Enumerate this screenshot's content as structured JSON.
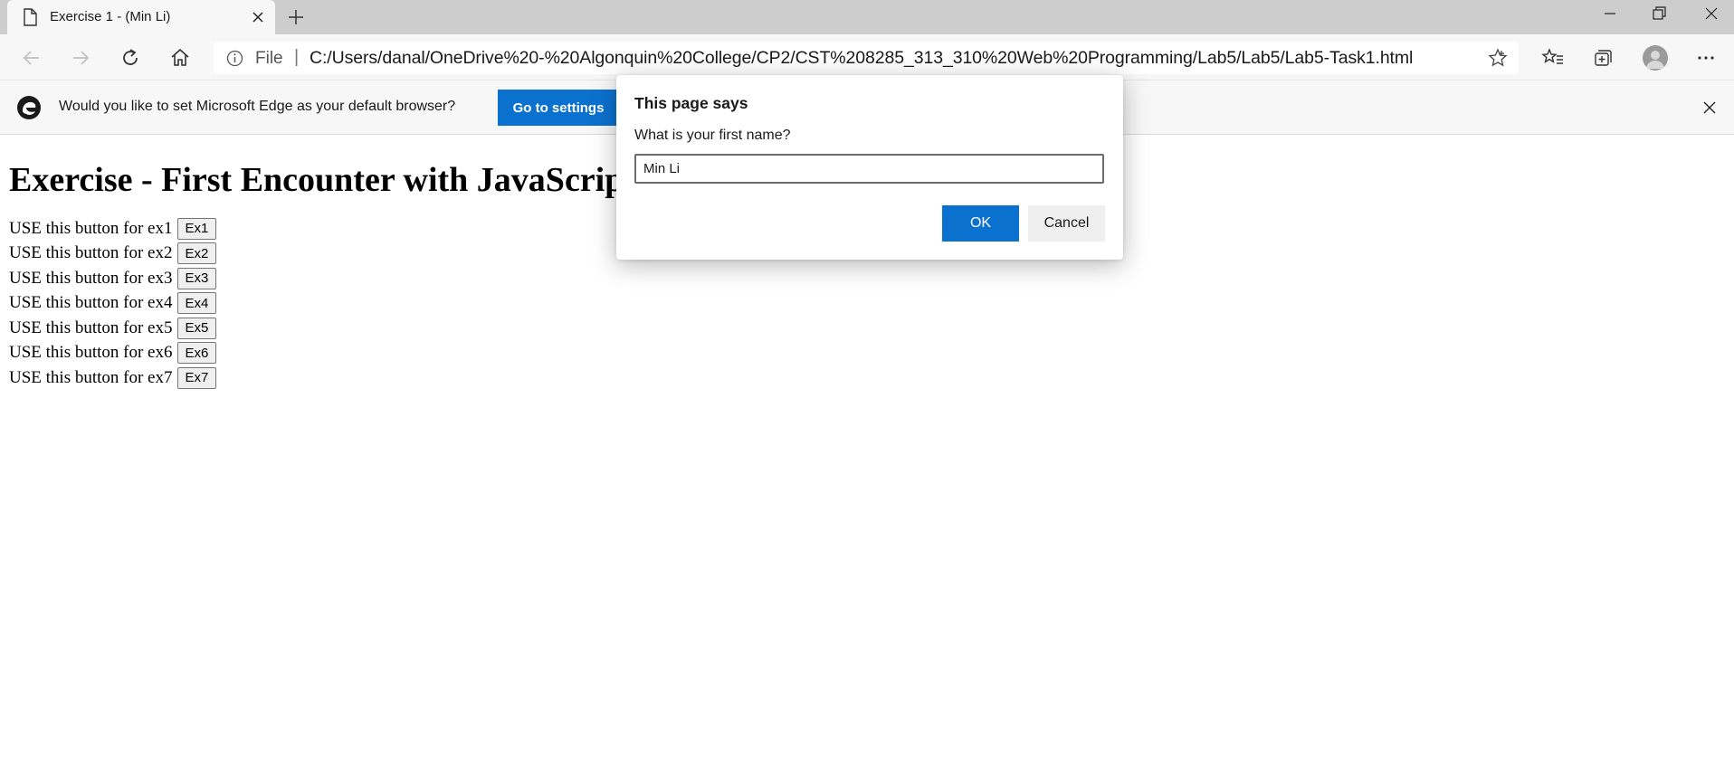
{
  "browser": {
    "tab": {
      "title": "Exercise 1 - (Min Li)"
    },
    "address": {
      "scheme": "File",
      "separator": "|",
      "url": "C:/Users/danal/OneDrive%20-%20Algonquin%20College/CP2/CST%208285_313_310%20Web%20Programming/Lab5/Lab5/Lab5-Task1.html"
    },
    "icons": {
      "tab": [
        "page-icon",
        "close-icon",
        "plus-icon"
      ],
      "window": [
        "minimize-icon",
        "restore-icon",
        "close-icon"
      ],
      "toolbar": [
        "back-arrow-icon",
        "forward-arrow-icon",
        "refresh-icon",
        "home-icon",
        "info-icon",
        "star-icon",
        "favorites-icon",
        "collections-icon",
        "profile-icon",
        "more-icon"
      ]
    }
  },
  "infobar": {
    "message": "Would you like to set Microsoft Edge as your default browser?",
    "button_label": "Go to settings"
  },
  "page": {
    "heading": "Exercise - First Encounter with JavaScript",
    "rows": [
      {
        "label": "USE this button for ex1",
        "button": "Ex1"
      },
      {
        "label": "USE this button for ex2",
        "button": "Ex2"
      },
      {
        "label": "USE this button for ex3",
        "button": "Ex3"
      },
      {
        "label": "USE this button for ex4",
        "button": "Ex4"
      },
      {
        "label": "USE this button for ex5",
        "button": "Ex5"
      },
      {
        "label": "USE this button for ex6",
        "button": "Ex6"
      },
      {
        "label": "USE this button for ex7",
        "button": "Ex7"
      }
    ]
  },
  "dialog": {
    "title": "This page says",
    "message": "What is your first name?",
    "input_value": "Min Li",
    "ok_label": "OK",
    "cancel_label": "Cancel"
  },
  "colors": {
    "accent": "#0b71cf",
    "tabstrip": "#cdcdcd",
    "toolbar": "#f7f7f7"
  }
}
